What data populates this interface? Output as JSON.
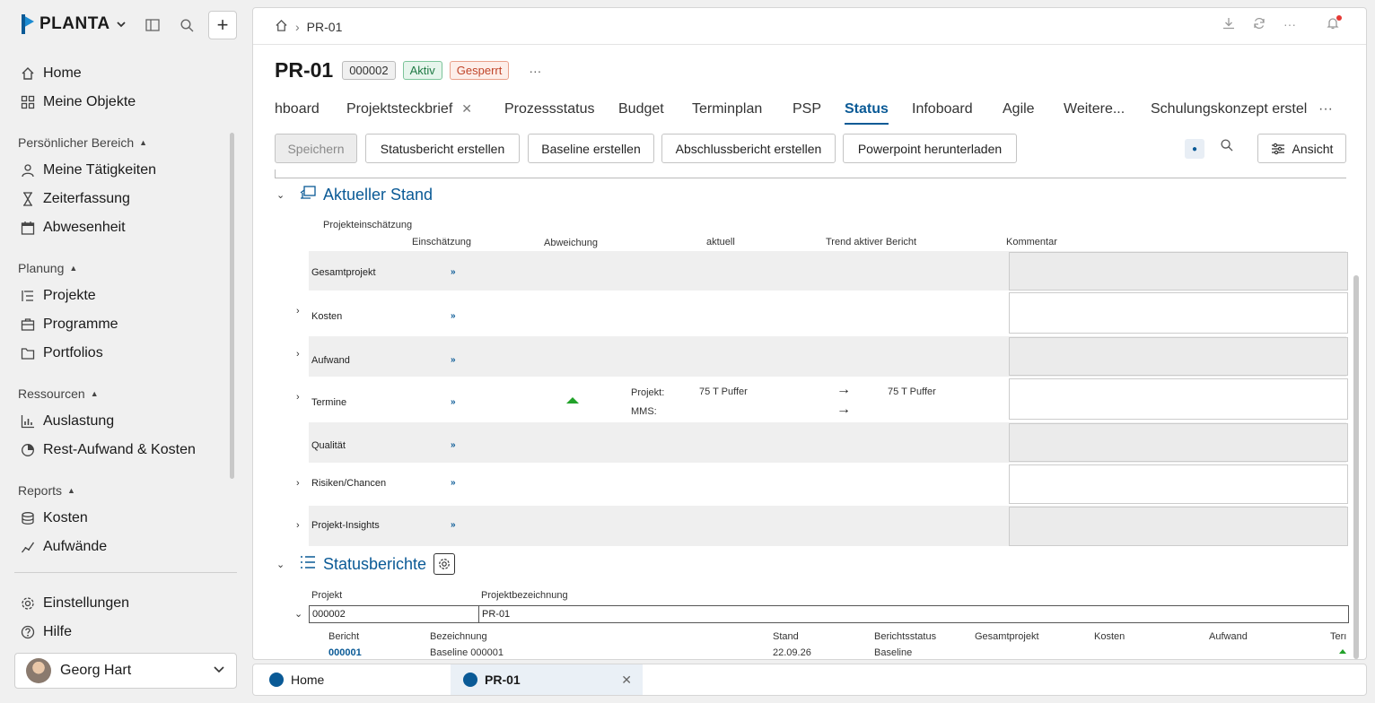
{
  "sidebar": {
    "logo_text": "PLANTA",
    "nav_top": [
      {
        "label": "Home",
        "icon": "home-icon"
      },
      {
        "label": "Meine Objekte",
        "icon": "grid-icon"
      }
    ],
    "sections": [
      {
        "title": "Persönlicher Bereich",
        "items": [
          {
            "label": "Meine Tätigkeiten",
            "icon": "person-icon"
          },
          {
            "label": "Zeiterfassung",
            "icon": "hourglass-icon"
          },
          {
            "label": "Abwesenheit",
            "icon": "calendar-icon"
          }
        ]
      },
      {
        "title": "Planung",
        "items": [
          {
            "label": "Projekte",
            "icon": "project-list-icon"
          },
          {
            "label": "Programme",
            "icon": "briefcase-icon"
          },
          {
            "label": "Portfolios",
            "icon": "folder-icon"
          }
        ]
      },
      {
        "title": "Ressourcen",
        "items": [
          {
            "label": "Auslastung",
            "icon": "bar-chart-icon"
          },
          {
            "label": "Rest-Aufwand & Kosten",
            "icon": "pie-chart-icon"
          }
        ]
      },
      {
        "title": "Reports",
        "items": [
          {
            "label": "Kosten",
            "icon": "coins-icon"
          },
          {
            "label": "Aufwände",
            "icon": "trend-icon"
          }
        ]
      }
    ],
    "bottom": [
      {
        "label": "Einstellungen",
        "icon": "gear-icon"
      },
      {
        "label": "Hilfe",
        "icon": "help-icon"
      }
    ],
    "user_name": "Georg Hart"
  },
  "header": {
    "breadcrumb_current": "PR-01",
    "title": "PR-01",
    "badge_id": "000002",
    "badge_status": "Aktiv",
    "badge_lock": "Gesperrt",
    "more": "···"
  },
  "tabs": [
    {
      "label": "hboard"
    },
    {
      "label": "Projektsteckbrief"
    },
    {
      "label": "Prozessstatus"
    },
    {
      "label": "Budget"
    },
    {
      "label": "Terminplan"
    },
    {
      "label": "PSP"
    },
    {
      "label": "Status"
    },
    {
      "label": "Infoboard"
    },
    {
      "label": "Agile"
    },
    {
      "label": "Weitere..."
    },
    {
      "label": "Schulungskonzept erstel"
    }
  ],
  "toolbar": {
    "save": "Speichern",
    "status_report": "Statusbericht erstellen",
    "baseline": "Baseline erstellen",
    "final_report": "Abschlussbericht erstellen",
    "powerpoint": "Powerpoint herunterladen",
    "view": "Ansicht"
  },
  "current": {
    "title": "Aktueller Stand",
    "group_label": "Projekteinschätzung",
    "columns": {
      "assessment": "Einschätzung",
      "deviation": "Abweichung",
      "current": "aktuell",
      "trend": "Trend aktiver Bericht",
      "comment": "Kommentar"
    },
    "rows": [
      {
        "label": "Gesamtprojekt",
        "link": "»"
      },
      {
        "label": "Kosten",
        "link": "»"
      },
      {
        "label": "Aufwand",
        "link": "»"
      },
      {
        "label": "Termine",
        "link": "»"
      },
      {
        "label": "Qualität",
        "link": "»"
      },
      {
        "label": "Risiken/Chancen",
        "link": "»"
      },
      {
        "label": "Projekt-Insights",
        "link": "»"
      }
    ],
    "termine_detail": {
      "projekt_label": "Projekt:",
      "mms_label": "MMS:",
      "current_value": "75 T Puffer",
      "trend_value": "75 T Puffer",
      "deviation_color": "#22a22a"
    }
  },
  "reports": {
    "title": "Statusberichte",
    "col_project": "Projekt",
    "col_project_name": "Projektbezeichnung",
    "project_value": "000002",
    "project_name_value": "PR-01",
    "sub_columns": [
      "Bericht",
      "Bezeichnung",
      "Stand",
      "Berichtsstatus",
      "Gesamtprojekt",
      "Kosten",
      "Aufwand",
      "Terı"
    ],
    "row": {
      "bericht": "000001",
      "bezeichnung": "Baseline 000001",
      "stand": "22.09.26",
      "status": "Baseline"
    }
  },
  "bottom_tabs": [
    {
      "label": "Home"
    },
    {
      "label": "PR-01"
    }
  ],
  "colors": {
    "accent": "#0a5a96",
    "active_badge": "#207a45",
    "locked_badge": "#c0452a"
  }
}
